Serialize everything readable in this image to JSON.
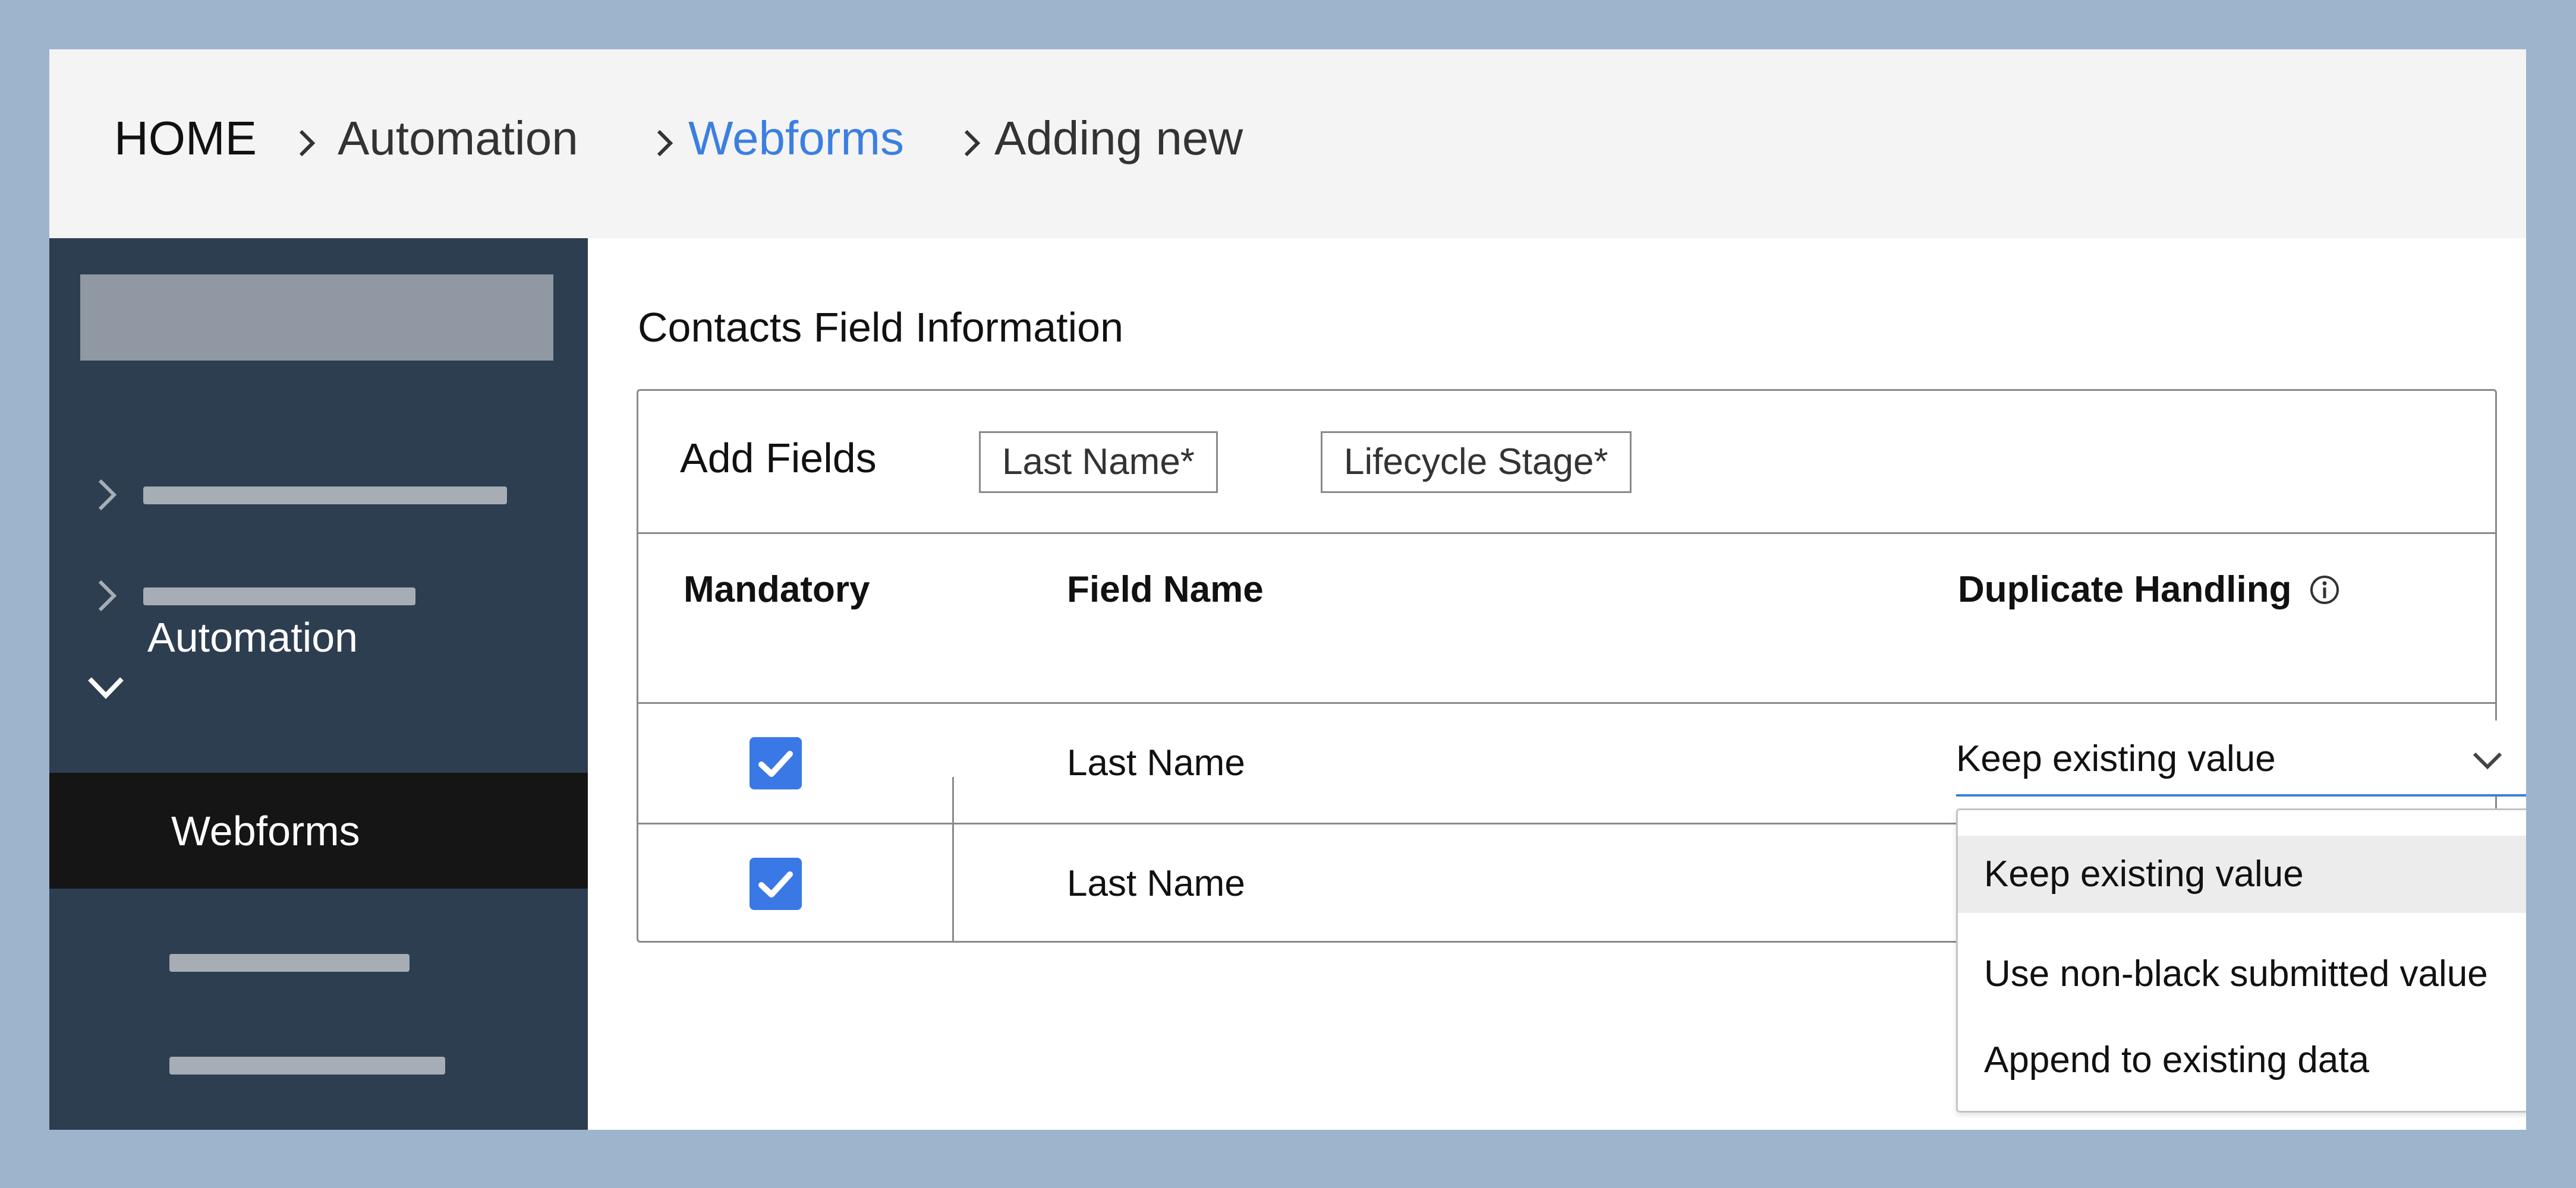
{
  "breadcrumb": {
    "items": [
      {
        "label": "HOME"
      },
      {
        "label": "Automation"
      },
      {
        "label": "Webforms"
      },
      {
        "label": "Adding new"
      }
    ]
  },
  "sidebar": {
    "expanded_section": "Automation",
    "active_item": "Webforms"
  },
  "main": {
    "section_title": "Contacts Field Information",
    "add_fields": {
      "label": "Add Fields",
      "chips": [
        "Last Name*",
        "Lifecycle Stage*"
      ]
    },
    "table": {
      "headers": {
        "mandatory": "Mandatory",
        "field_name": "Field Name",
        "duplicate_handling": "Duplicate Handling"
      },
      "rows": [
        {
          "mandatory": true,
          "field_name": "Last Name",
          "duplicate_handling": "Keep existing value"
        },
        {
          "mandatory": true,
          "field_name": "Last Name"
        }
      ]
    },
    "dropdown": {
      "options": [
        "Keep existing value",
        "Use non-black submitted value",
        "Append to existing data"
      ],
      "highlighted_option": "Keep existing value"
    }
  },
  "colors": {
    "outer_background": "#9db4cd",
    "header_background": "#f4f4f4",
    "sidebar_background": "#2d3e50",
    "sidebar_active": "#151515",
    "accent": "#3b7fe0",
    "checkbox": "#3a78e6"
  },
  "icons": {
    "breadcrumb_separator": "chevron-right-icon",
    "sidebar_collapsed": "chevron-right-icon",
    "sidebar_expanded": "chevron-down-icon",
    "info": "info-icon",
    "select": "chevron-down-icon",
    "checkbox": "check-icon"
  }
}
